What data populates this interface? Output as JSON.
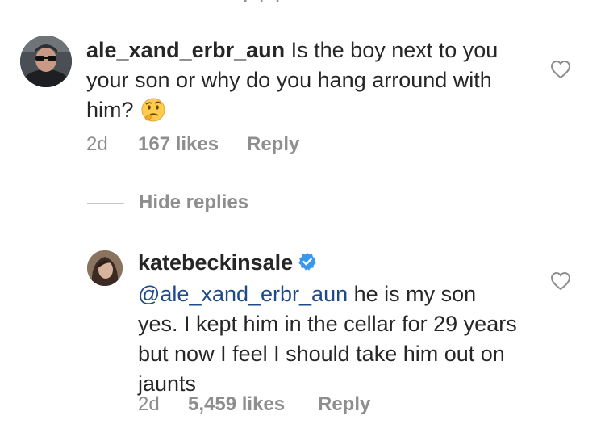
{
  "comments": [
    {
      "username": "ale_xand_erbr_aun",
      "text": "Is the boy next to you your son or why do you hang arround with him?",
      "emoji": "thinking-face",
      "time": "2d",
      "likes": "167 likes",
      "reply_label": "Reply",
      "avatar": "profile-photo-man-sunglasses"
    },
    {
      "username": "katebeckinsale",
      "verified": true,
      "mention": "@ale_xand_erbr_aun",
      "text": "he is my son yes. I kept him in the cellar for 29 years but now I feel I should take him out on jaunts",
      "time": "2d",
      "likes": "5,459 likes",
      "reply_label": "Reply",
      "avatar": "profile-photo-woman"
    }
  ],
  "replies_toggle": {
    "label": "Hide replies"
  },
  "colors": {
    "text": "#262626",
    "muted": "#8e8e8e",
    "mention": "#1f4a8a",
    "verified": "#3897f0"
  },
  "icons": [
    "heart-outline-icon",
    "verified-badge-icon",
    "thinking-face-emoji"
  ]
}
